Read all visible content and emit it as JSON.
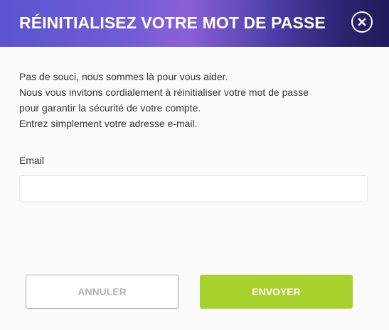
{
  "dialog": {
    "title": "RÉINITIALISEZ VOTRE MOT DE PASSE",
    "close_icon": "close-icon"
  },
  "intro": {
    "lines": [
      "Pas de souci, nous sommes là pour vous aider.",
      "Nous vous invitons cordialement à réinitialiser votre mot de passe",
      "pour garantir la sécurité de votre compte.",
      "Entrez simplement votre adresse e-mail."
    ]
  },
  "form": {
    "email_label": "Email",
    "email_value": "",
    "email_placeholder": ""
  },
  "actions": {
    "cancel_label": "ANNULER",
    "send_label": "ENVOYER"
  },
  "colors": {
    "header_gradient_start": "#5b54cf",
    "header_gradient_end": "#1f1b5a",
    "send_button": "#a9d12d",
    "cancel_text": "#b3b3b3"
  }
}
